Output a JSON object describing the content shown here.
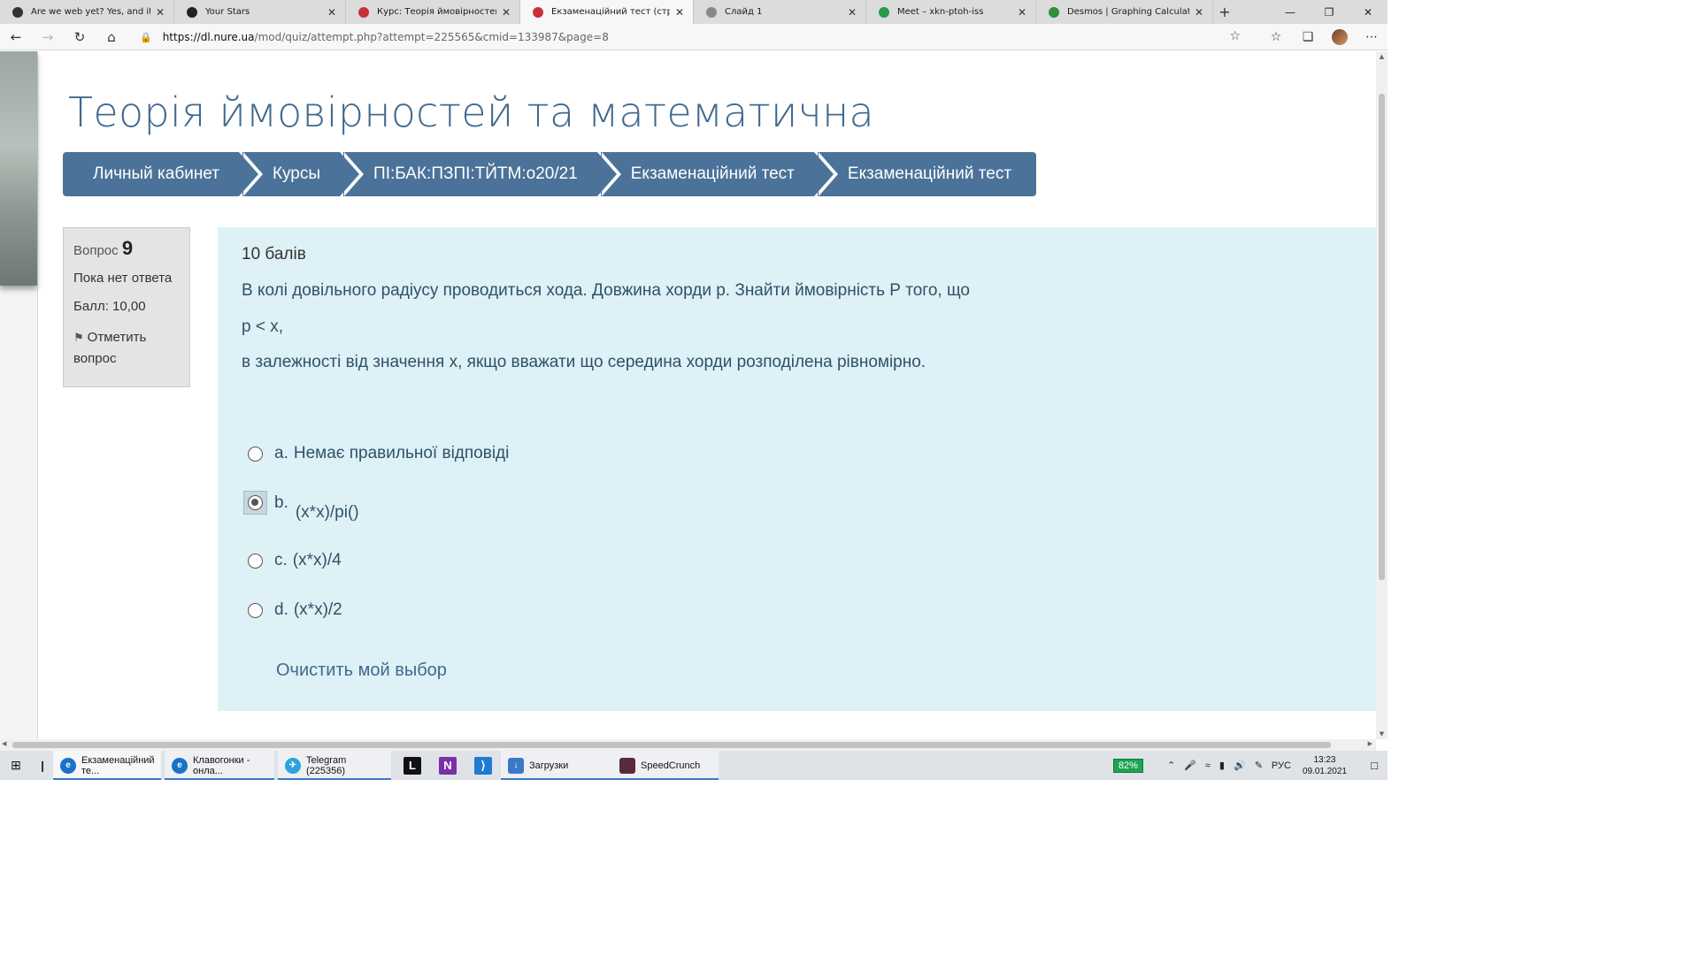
{
  "browser": {
    "tabs": [
      {
        "title": "Are we web yet? Yes, and it's free",
        "fav_color": "#333333",
        "width": 197,
        "active": false
      },
      {
        "title": "Your Stars",
        "fav_color": "#222222",
        "width": 194,
        "active": false
      },
      {
        "title": "Курс: Теорія ймовірностей та м",
        "fav_color": "#c8313a",
        "width": 197,
        "active": false
      },
      {
        "title": "Екзаменаційний тест (страница",
        "fav_color": "#c8313a",
        "width": 196,
        "active": true
      },
      {
        "title": "Слайд 1",
        "fav_color": "#888888",
        "width": 195,
        "active": false
      },
      {
        "title": "Meet – xkn-ptoh-iss",
        "fav_color": "#2b9a48",
        "width": 192,
        "active": false
      },
      {
        "title": "Desmos | Graphing Calculator",
        "fav_color": "#2f8f3a",
        "width": 200,
        "active": false
      }
    ],
    "address": {
      "host": "https://dl.nure.ua",
      "path": "/mod/quiz/attempt.php?attempt=225565&cmid=133987&page=8"
    }
  },
  "page": {
    "course_title": "Теорія ймовірностей та математична",
    "breadcrumb": [
      "Личный кабинет",
      "Курсы",
      "ПІ:БАК:ПЗПІ:ТЙТМ:о20/21",
      "Екзаменаційний тест",
      "Екзаменаційний тест"
    ],
    "info": {
      "question_label": "Вопрос",
      "question_number": "9",
      "state": "Пока нет ответа",
      "grade": "Балл: 10,00",
      "flag_label_1": "Отметить",
      "flag_label_2": "вопрос"
    },
    "question": {
      "points": "10 балів",
      "text_line1": "В колі довільного радіусу проводиться хода. Довжина хорди р. Знайти ймовірність Р того, що",
      "text_line2": "р < x,",
      "text_line3": "в залежності від значення x, якщо вважати що середина хорди розподілена рівномірно.",
      "options": [
        {
          "letter": "a.",
          "text": "Немає правильної відповіді",
          "selected": false
        },
        {
          "letter": "b.",
          "text": "(x*x)/pi()",
          "selected": true
        },
        {
          "letter": "c.",
          "text": "(x*x)/4",
          "selected": false
        },
        {
          "letter": "d.",
          "text": "(x*x)/2",
          "selected": false
        }
      ],
      "clear_label": "Очистить мой выбор"
    }
  },
  "taskbar": {
    "items": [
      {
        "label": "Екзаменаційний те...",
        "color": "#1a73c9",
        "glyph": "e"
      },
      {
        "label": "Клавогонки - онла...",
        "color": "#1a73c9",
        "glyph": "e"
      },
      {
        "label": "Telegram (225356)",
        "color": "#2aa3de",
        "glyph": "✈"
      }
    ],
    "apps": [
      {
        "name": "literature-icon",
        "glyph": "L",
        "color": "#111111"
      },
      {
        "name": "onenote-icon",
        "glyph": "N",
        "color": "#7b2fa8"
      },
      {
        "name": "vscode-icon",
        "glyph": "⟩",
        "color": "#1f7ad0"
      }
    ],
    "downloads_label": "Загрузки",
    "speedcrunch_label": "SpeedCrunch",
    "battery": "82%",
    "lang": "РУС",
    "time": "13:23",
    "date": "09.01.2021"
  }
}
